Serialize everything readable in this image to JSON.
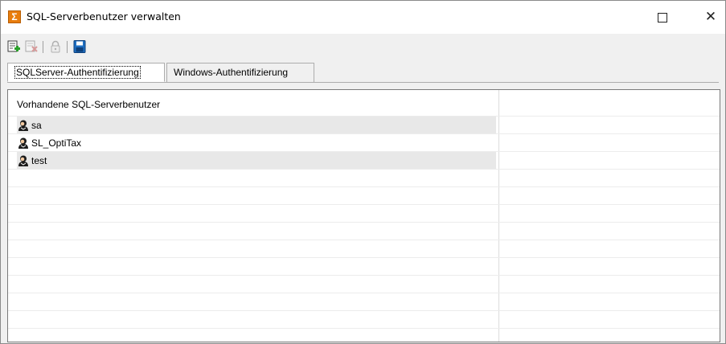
{
  "window": {
    "title": "SQL-Serverbenutzer verwalten",
    "app_icon_glyph": "Σ",
    "maximize_label": "",
    "close_glyph": "✕"
  },
  "toolbar": {
    "buttons": [
      {
        "icon": "add-user-icon",
        "enabled": true
      },
      {
        "icon": "delete-user-icon",
        "enabled": false
      },
      {
        "icon": "lock-icon",
        "enabled": false
      },
      {
        "icon": "save-icon",
        "enabled": true
      }
    ]
  },
  "tabs": [
    {
      "label": "SQLServer-Authentifizierung",
      "active": true
    },
    {
      "label": "Windows-Authentifizierung",
      "active": false
    }
  ],
  "list": {
    "header": "Vorhandene SQL-Serverbenutzer",
    "users": [
      {
        "name": "sa"
      },
      {
        "name": "SL_OptiTax"
      },
      {
        "name": "test"
      }
    ]
  },
  "colors": {
    "accent": "#e87d0d",
    "row_alt": "#e8e8e8",
    "save_blue": "#1e6fc2"
  }
}
